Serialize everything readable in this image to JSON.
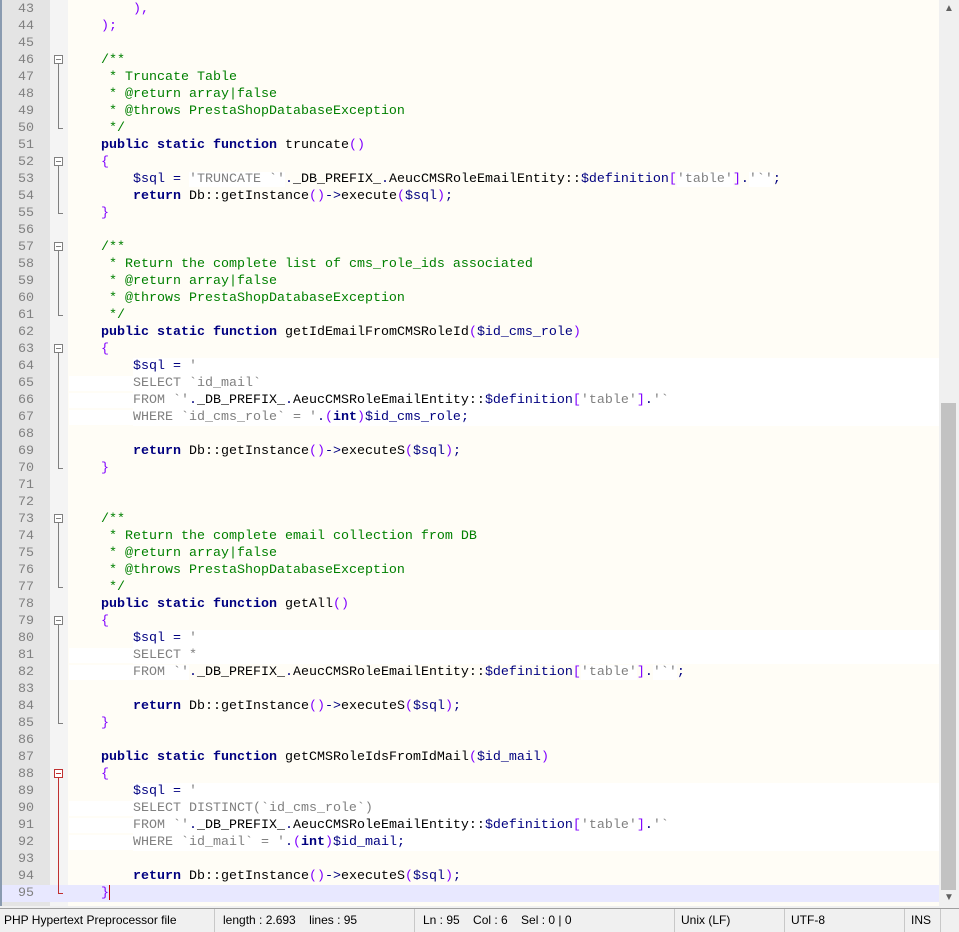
{
  "editor": {
    "current_line": 95,
    "scroll_fraction": 0.82,
    "lines": [
      {
        "n": "43",
        "t": [
          [
            "d",
            "        "
          ],
          [
            "o",
            "),"
          ]
        ]
      },
      {
        "n": "44",
        "t": [
          [
            "d",
            "    "
          ],
          [
            "o",
            ");"
          ]
        ]
      },
      {
        "n": "45",
        "t": []
      },
      {
        "n": "46",
        "fold": "open",
        "t": [
          [
            "d",
            "    "
          ],
          [
            "c",
            "/**"
          ]
        ]
      },
      {
        "n": "47",
        "fold": "mid",
        "t": [
          [
            "d",
            "     "
          ],
          [
            "c",
            "* Truncate Table"
          ]
        ]
      },
      {
        "n": "48",
        "fold": "mid",
        "t": [
          [
            "d",
            "     "
          ],
          [
            "c",
            "* @return array|false"
          ]
        ]
      },
      {
        "n": "49",
        "fold": "mid",
        "t": [
          [
            "d",
            "     "
          ],
          [
            "c",
            "* @throws PrestaShopDatabaseException"
          ]
        ]
      },
      {
        "n": "50",
        "fold": "end",
        "t": [
          [
            "d",
            "     "
          ],
          [
            "c",
            "*/"
          ]
        ]
      },
      {
        "n": "51",
        "t": [
          [
            "d",
            "    "
          ],
          [
            "k",
            "public static function"
          ],
          [
            "d",
            " truncate"
          ],
          [
            "o",
            "()"
          ]
        ]
      },
      {
        "n": "52",
        "fold": "open",
        "t": [
          [
            "d",
            "    "
          ],
          [
            "o",
            "{"
          ]
        ]
      },
      {
        "n": "53",
        "fold": "mid",
        "t": [
          [
            "d",
            "        "
          ],
          [
            "v",
            "$sql"
          ],
          [
            "n",
            " = "
          ],
          [
            "s",
            "'TRUNCATE `'"
          ],
          [
            "n",
            "."
          ],
          [
            "d",
            "_DB_PREFIX_"
          ],
          [
            "n",
            "."
          ],
          [
            "d",
            "AeucCMSRoleEmailEntity::"
          ],
          [
            "v",
            "$definition"
          ],
          [
            "o",
            "["
          ],
          [
            "s",
            "'table'"
          ],
          [
            "o",
            "]"
          ],
          [
            "n",
            "."
          ],
          [
            "s",
            "'`'"
          ],
          [
            "n",
            ";"
          ]
        ]
      },
      {
        "n": "54",
        "fold": "mid",
        "t": [
          [
            "d",
            "        "
          ],
          [
            "k",
            "return"
          ],
          [
            "d",
            " Db::getInstance"
          ],
          [
            "o",
            "()"
          ],
          [
            "n",
            "->"
          ],
          [
            "d",
            "execute"
          ],
          [
            "o",
            "("
          ],
          [
            "v",
            "$sql"
          ],
          [
            "o",
            ")"
          ],
          [
            "n",
            ";"
          ]
        ]
      },
      {
        "n": "55",
        "fold": "end",
        "t": [
          [
            "d",
            "    "
          ],
          [
            "o",
            "}"
          ]
        ]
      },
      {
        "n": "56",
        "t": []
      },
      {
        "n": "57",
        "fold": "open",
        "t": [
          [
            "d",
            "    "
          ],
          [
            "c",
            "/**"
          ]
        ]
      },
      {
        "n": "58",
        "fold": "mid",
        "t": [
          [
            "d",
            "     "
          ],
          [
            "c",
            "* Return the complete list of cms_role_ids associated"
          ]
        ]
      },
      {
        "n": "59",
        "fold": "mid",
        "t": [
          [
            "d",
            "     "
          ],
          [
            "c",
            "* @return array|false"
          ]
        ]
      },
      {
        "n": "60",
        "fold": "mid",
        "t": [
          [
            "d",
            "     "
          ],
          [
            "c",
            "* @throws PrestaShopDatabaseException"
          ]
        ]
      },
      {
        "n": "61",
        "fold": "end",
        "t": [
          [
            "d",
            "     "
          ],
          [
            "c",
            "*/"
          ]
        ]
      },
      {
        "n": "62",
        "t": [
          [
            "d",
            "    "
          ],
          [
            "k",
            "public static function"
          ],
          [
            "d",
            " getIdEmailFromCMSRoleId"
          ],
          [
            "o",
            "("
          ],
          [
            "v",
            "$id_cms_role"
          ],
          [
            "o",
            ")"
          ]
        ]
      },
      {
        "n": "63",
        "fold": "open",
        "t": [
          [
            "d",
            "    "
          ],
          [
            "o",
            "{"
          ]
        ]
      },
      {
        "n": "64",
        "fold": "mid",
        "sf": true,
        "t": [
          [
            "d",
            "        "
          ],
          [
            "v",
            "$sql"
          ],
          [
            "n",
            " = "
          ],
          [
            "s",
            "'"
          ]
        ]
      },
      {
        "n": "65",
        "fold": "mid",
        "sf": true,
        "t": [
          [
            "s",
            "        SELECT `id_mail`"
          ]
        ]
      },
      {
        "n": "66",
        "fold": "mid",
        "sf": true,
        "t": [
          [
            "s",
            "        FROM `'"
          ],
          [
            "n",
            "."
          ],
          [
            "d",
            "_DB_PREFIX_"
          ],
          [
            "n",
            "."
          ],
          [
            "d",
            "AeucCMSRoleEmailEntity::"
          ],
          [
            "v",
            "$definition"
          ],
          [
            "o",
            "["
          ],
          [
            "s",
            "'table'"
          ],
          [
            "o",
            "]"
          ],
          [
            "n",
            "."
          ],
          [
            "s",
            "'`"
          ]
        ]
      },
      {
        "n": "67",
        "fold": "mid",
        "sf": true,
        "t": [
          [
            "s",
            "        WHERE `id_cms_role` = '"
          ],
          [
            "n",
            "."
          ],
          [
            "o",
            "("
          ],
          [
            "k",
            "int"
          ],
          [
            "o",
            ")"
          ],
          [
            "v",
            "$id_cms_role"
          ],
          [
            "n",
            ";"
          ]
        ]
      },
      {
        "n": "68",
        "fold": "mid",
        "t": []
      },
      {
        "n": "69",
        "fold": "mid",
        "t": [
          [
            "d",
            "        "
          ],
          [
            "k",
            "return"
          ],
          [
            "d",
            " Db::getInstance"
          ],
          [
            "o",
            "()"
          ],
          [
            "n",
            "->"
          ],
          [
            "d",
            "executeS"
          ],
          [
            "o",
            "("
          ],
          [
            "v",
            "$sql"
          ],
          [
            "o",
            ")"
          ],
          [
            "n",
            ";"
          ]
        ]
      },
      {
        "n": "70",
        "fold": "end",
        "t": [
          [
            "d",
            "    "
          ],
          [
            "o",
            "}"
          ]
        ]
      },
      {
        "n": "71",
        "t": []
      },
      {
        "n": "72",
        "t": []
      },
      {
        "n": "73",
        "fold": "open",
        "t": [
          [
            "d",
            "    "
          ],
          [
            "c",
            "/**"
          ]
        ]
      },
      {
        "n": "74",
        "fold": "mid",
        "t": [
          [
            "d",
            "     "
          ],
          [
            "c",
            "* Return the complete email collection from DB"
          ]
        ]
      },
      {
        "n": "75",
        "fold": "mid",
        "t": [
          [
            "d",
            "     "
          ],
          [
            "c",
            "* @return array|false"
          ]
        ]
      },
      {
        "n": "76",
        "fold": "mid",
        "t": [
          [
            "d",
            "     "
          ],
          [
            "c",
            "* @throws PrestaShopDatabaseException"
          ]
        ]
      },
      {
        "n": "77",
        "fold": "end",
        "t": [
          [
            "d",
            "     "
          ],
          [
            "c",
            "*/"
          ]
        ]
      },
      {
        "n": "78",
        "t": [
          [
            "d",
            "    "
          ],
          [
            "k",
            "public static function"
          ],
          [
            "d",
            " getAll"
          ],
          [
            "o",
            "()"
          ]
        ]
      },
      {
        "n": "79",
        "fold": "open",
        "t": [
          [
            "d",
            "    "
          ],
          [
            "o",
            "{"
          ]
        ]
      },
      {
        "n": "80",
        "fold": "mid",
        "sf": true,
        "t": [
          [
            "d",
            "        "
          ],
          [
            "v",
            "$sql"
          ],
          [
            "n",
            " = "
          ],
          [
            "s",
            "'"
          ]
        ]
      },
      {
        "n": "81",
        "fold": "mid",
        "sf": true,
        "t": [
          [
            "s",
            "        SELECT *"
          ]
        ]
      },
      {
        "n": "82",
        "fold": "mid",
        "t": [
          [
            "s",
            "        FROM `'"
          ],
          [
            "n",
            "."
          ],
          [
            "d",
            "_DB_PREFIX_"
          ],
          [
            "n",
            "."
          ],
          [
            "d",
            "AeucCMSRoleEmailEntity::"
          ],
          [
            "v",
            "$definition"
          ],
          [
            "o",
            "["
          ],
          [
            "s",
            "'table'"
          ],
          [
            "o",
            "]"
          ],
          [
            "n",
            "."
          ],
          [
            "s",
            "'`'"
          ],
          [
            "n",
            ";"
          ]
        ]
      },
      {
        "n": "83",
        "fold": "mid",
        "t": []
      },
      {
        "n": "84",
        "fold": "mid",
        "t": [
          [
            "d",
            "        "
          ],
          [
            "k",
            "return"
          ],
          [
            "d",
            " Db::getInstance"
          ],
          [
            "o",
            "()"
          ],
          [
            "n",
            "->"
          ],
          [
            "d",
            "executeS"
          ],
          [
            "o",
            "("
          ],
          [
            "v",
            "$sql"
          ],
          [
            "o",
            ")"
          ],
          [
            "n",
            ";"
          ]
        ]
      },
      {
        "n": "85",
        "fold": "end",
        "t": [
          [
            "d",
            "    "
          ],
          [
            "o",
            "}"
          ]
        ]
      },
      {
        "n": "86",
        "t": []
      },
      {
        "n": "87",
        "t": [
          [
            "d",
            "    "
          ],
          [
            "k",
            "public static function"
          ],
          [
            "d",
            " getCMSRoleIdsFromIdMail"
          ],
          [
            "o",
            "("
          ],
          [
            "v",
            "$id_mail"
          ],
          [
            "o",
            ")"
          ]
        ]
      },
      {
        "n": "88",
        "fold": "open",
        "red": true,
        "t": [
          [
            "d",
            "    "
          ],
          [
            "o",
            "{"
          ]
        ]
      },
      {
        "n": "89",
        "fold": "mid",
        "red": true,
        "sf": true,
        "t": [
          [
            "d",
            "        "
          ],
          [
            "v",
            "$sql"
          ],
          [
            "n",
            " = "
          ],
          [
            "s",
            "'"
          ]
        ]
      },
      {
        "n": "90",
        "fold": "mid",
        "red": true,
        "sf": true,
        "t": [
          [
            "s",
            "        SELECT DISTINCT(`id_cms_role`)"
          ]
        ]
      },
      {
        "n": "91",
        "fold": "mid",
        "red": true,
        "sf": true,
        "t": [
          [
            "s",
            "        FROM `'"
          ],
          [
            "n",
            "."
          ],
          [
            "d",
            "_DB_PREFIX_"
          ],
          [
            "n",
            "."
          ],
          [
            "d",
            "AeucCMSRoleEmailEntity::"
          ],
          [
            "v",
            "$definition"
          ],
          [
            "o",
            "["
          ],
          [
            "s",
            "'table'"
          ],
          [
            "o",
            "]"
          ],
          [
            "n",
            "."
          ],
          [
            "s",
            "'`"
          ]
        ]
      },
      {
        "n": "92",
        "fold": "mid",
        "red": true,
        "sf": true,
        "t": [
          [
            "s",
            "        WHERE `id_mail` = '"
          ],
          [
            "n",
            "."
          ],
          [
            "o",
            "("
          ],
          [
            "k",
            "int"
          ],
          [
            "o",
            ")"
          ],
          [
            "v",
            "$id_mail"
          ],
          [
            "n",
            ";"
          ]
        ]
      },
      {
        "n": "93",
        "fold": "mid",
        "red": true,
        "t": []
      },
      {
        "n": "94",
        "fold": "mid",
        "red": true,
        "t": [
          [
            "d",
            "        "
          ],
          [
            "k",
            "return"
          ],
          [
            "d",
            " Db::getInstance"
          ],
          [
            "o",
            "()"
          ],
          [
            "n",
            "->"
          ],
          [
            "d",
            "executeS"
          ],
          [
            "o",
            "("
          ],
          [
            "v",
            "$sql"
          ],
          [
            "o",
            ")"
          ],
          [
            "n",
            ";"
          ]
        ]
      },
      {
        "n": "95",
        "fold": "end",
        "red": true,
        "caret": true,
        "t": [
          [
            "d",
            "    "
          ],
          [
            "o",
            "}"
          ]
        ]
      }
    ]
  },
  "status": {
    "file_type": "PHP Hypertext Preprocessor file",
    "length_lines": "length : 2.693    lines : 95",
    "position": "Ln : 95    Col : 6    Sel : 0 | 0",
    "eol": "Unix (LF)",
    "encoding": "UTF-8",
    "mode": "INS"
  },
  "scrollbar": {
    "up_arrow": "▲",
    "down_arrow": "▼"
  }
}
